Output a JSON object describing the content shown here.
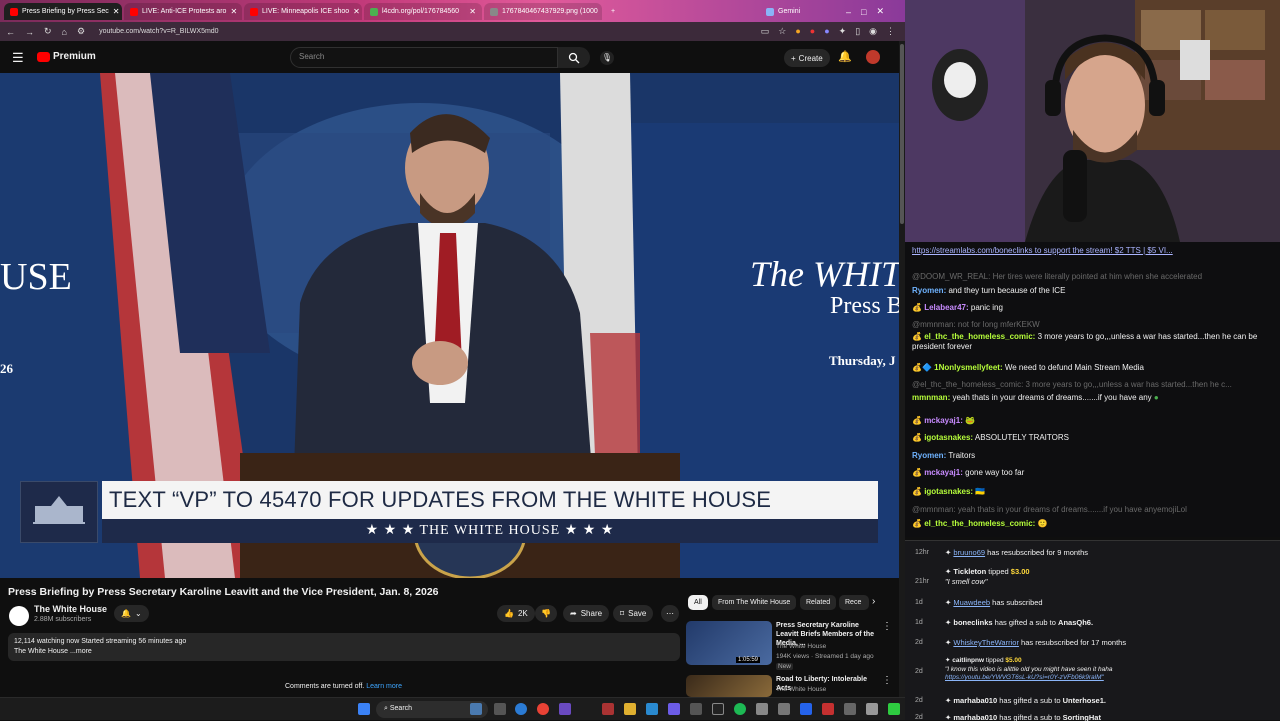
{
  "browser": {
    "tabs": [
      {
        "label": "Press Briefing by Press Sec",
        "color": "#ff0000",
        "active": true
      },
      {
        "label": "LIVE: Anti-ICE Protests aro",
        "color": "#ff0000"
      },
      {
        "label": "LIVE: Minneapolis ICE shoo",
        "color": "#ff0000"
      },
      {
        "label": "l4cdn.org/pol/176784560",
        "color": "#4caf50"
      },
      {
        "label": "1767840467437929.png (1000",
        "color": "#888888"
      },
      {
        "label": "Gemini",
        "color": "#8ab4f8"
      }
    ],
    "url": "youtube.com/watch?v=R_BILWX5md0"
  },
  "youtube": {
    "logo": "Premium",
    "search_placeholder": "Search",
    "create_label": "Create",
    "video": {
      "lower_third_title": "TEXT “VP” TO 45470 FOR UPDATES FROM THE WHITE HOUSE",
      "lower_third_sub": "★ ★ ★  THE WHITE HOUSE  ★ ★ ★",
      "banner_left": "USE",
      "banner_right": "The WHIT",
      "banner_right2": "Press B",
      "banner_right3": "Thursday, J",
      "banner_left_num": "26"
    },
    "title": "Press Briefing by Press Secretary Karoline Leavitt and the Vice President, Jan. 8, 2026",
    "channel": "The White House",
    "subscribers": "2.88M subscribers",
    "likes": "2K",
    "share_label": "Share",
    "save_label": "Save",
    "watching": "12,114 watching now  Started streaming 56 minutes ago",
    "desc_line2": "The White House ...more",
    "comments_off": "Comments are turned off.",
    "learn_more": "Learn more",
    "chips": [
      "All",
      "From The White House",
      "Related",
      "Rece"
    ],
    "recs": [
      {
        "title": "Press Secretary Karoline Leavitt Briefs Members of the Media, ...",
        "channel": "The White House",
        "meta": "194K views · Streamed 1 day ago",
        "badge": "New",
        "duration": "1:05:59"
      },
      {
        "title": "Road to Liberty: Intolerable Acts",
        "channel": "The White House"
      }
    ]
  },
  "taskbar": {
    "search": "Search"
  },
  "chat": {
    "pinned": "https://streamlabs.com/boneclinks to support the stream! $2 TTS | $5 VI...",
    "messages": [
      {
        "user": "",
        "text": "@DOOM_WR_REAL: Her tires were literally pointed at him when she accelerated",
        "reply": true
      },
      {
        "user": "Ryomen:",
        "text": " and they turn because of the ICE",
        "color": "#6fb3ff"
      },
      {
        "user": "Lelabear47:",
        "text": " panic ing",
        "color": "#c88bff"
      },
      {
        "user": "",
        "text": "@mmnman: not for long mferKEKW",
        "reply": true
      },
      {
        "user": "el_thc_the_homeless_comic:",
        "text": " 3 more years to go,,,unless a war has started...then he can be president forever",
        "color": "#b7ff3b"
      },
      {
        "user": "1Nonlysmellyfeet:",
        "text": " We need to defund Main Stream Media",
        "color": "#b7ff3b"
      },
      {
        "user": "",
        "text": "@el_thc_the_homeless_comic: 3 more years to go,,,unless a war has started...then he c...",
        "reply": true
      },
      {
        "user": "mmnman:",
        "text": " yeah thats in your dreams of dreams.......if you have any",
        "color": "#b7ff3b"
      },
      {
        "user": "mckayaj1:",
        "text": "",
        "color": "#c88bff"
      },
      {
        "user": "igotasnakes:",
        "text": " ABSOLUTELY TRAITORS",
        "color": "#b7ff3b"
      },
      {
        "user": "Ryomen:",
        "text": " Traitors",
        "color": "#6fb3ff"
      },
      {
        "user": "mckayaj1:",
        "text": " gone way too far",
        "color": "#c88bff"
      },
      {
        "user": "igotasnakes:",
        "text": "",
        "color": "#b7ff3b"
      },
      {
        "user": "",
        "text": "@mmnman: yeah thats in your dreams of dreams.......if you have anyemojiLol",
        "reply": true
      },
      {
        "user": "el_thc_the_homeless_comic:",
        "text": "",
        "color": "#b7ff3b"
      }
    ]
  },
  "events": [
    {
      "time": "12hr",
      "user": "bruuno69",
      "text": " has resubscribed for 9 months"
    },
    {
      "time": "21hr",
      "user": "Tickleton",
      "text": " tipped ",
      "amount": "$3.00",
      "note": "\"I smell cow\""
    },
    {
      "time": "1d",
      "user": "Muawdeeb",
      "text": " has subscribed"
    },
    {
      "time": "1d",
      "user": "boneclinks",
      "text": " has gifted a sub to ",
      "target": "AnasQh6."
    },
    {
      "time": "2d",
      "user": "WhiskeyTheWarrior",
      "text": " has resubscribed for 17 months"
    },
    {
      "time": "2d",
      "user": "caitlinpnw",
      "text": " tipped ",
      "amount": "$5.00",
      "note": "\"I know this video is alittle old you might have seen it haha",
      "link": "https://youtu.be/YWVGT6sL-kU?si=r0Y-zVFb06k9ralM\""
    },
    {
      "time": "2d",
      "user": "marhaba010",
      "text": " has gifted a sub to ",
      "target": "Unterhose1."
    },
    {
      "time": "2d",
      "user": "marhaba010",
      "text": " has gifted a sub to ",
      "target": "SortingHat"
    }
  ]
}
